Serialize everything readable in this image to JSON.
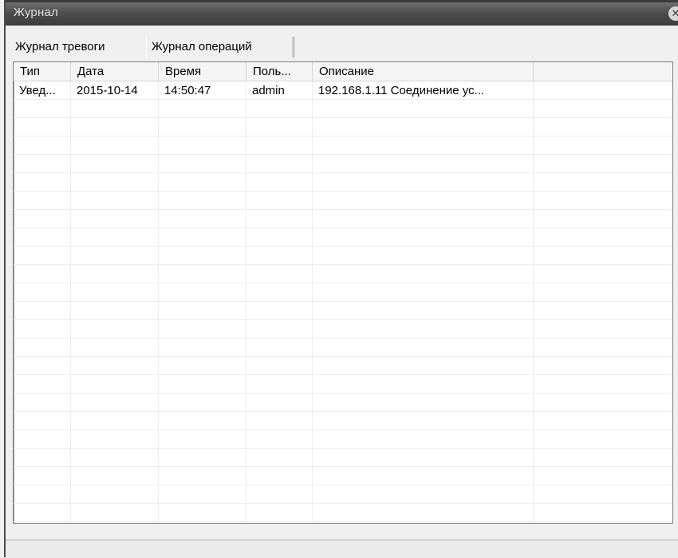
{
  "window": {
    "title": "Журнал"
  },
  "tabs": [
    {
      "label": "Журнал тревоги"
    },
    {
      "label": "Журнал операций"
    }
  ],
  "table": {
    "columns": [
      "Тип",
      "Дата",
      "Время",
      "Поль...",
      "Описание",
      ""
    ],
    "rows": [
      [
        "Увед...",
        "2015-10-14",
        "14:50:47",
        "admin",
        "192.168.1.11  Соединение ус...",
        ""
      ]
    ]
  },
  "icons": {
    "close": "close-icon"
  },
  "colors": {
    "titlebar": "#4d4d4d",
    "title_text": "#e0e0e0"
  }
}
